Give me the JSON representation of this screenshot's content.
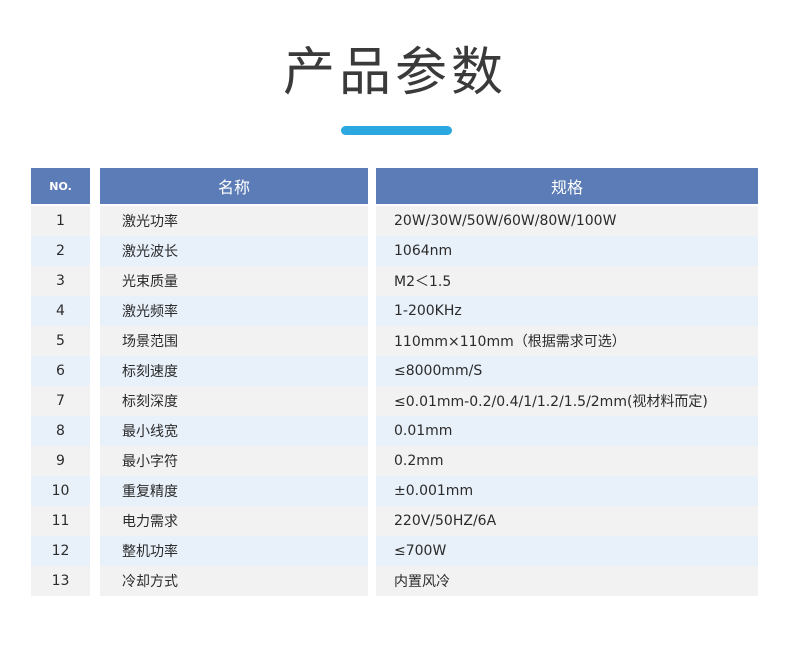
{
  "page": {
    "title": "产品参数"
  },
  "table": {
    "headers": {
      "no": "NO.",
      "name": "名称",
      "spec": "规格"
    },
    "rows": [
      {
        "no": "1",
        "name": "激光功率",
        "spec": "20W/30W/50W/60W/80W/100W"
      },
      {
        "no": "2",
        "name": "激光波长",
        "spec": "1064nm"
      },
      {
        "no": "3",
        "name": "光束质量",
        "spec": "M2＜1.5"
      },
      {
        "no": "4",
        "name": "激光频率",
        "spec": "1-200KHz"
      },
      {
        "no": "5",
        "name": "场景范围",
        "spec": "110mm×110mm（根据需求可选）"
      },
      {
        "no": "6",
        "name": "标刻速度",
        "spec": "≤8000mm/S"
      },
      {
        "no": "7",
        "name": "标刻深度",
        "spec": "≤0.01mm-0.2/0.4/1/1.2/1.5/2mm(视材料而定)"
      },
      {
        "no": "8",
        "name": "最小线宽",
        "spec": "0.01mm"
      },
      {
        "no": "9",
        "name": "最小字符",
        "spec": "0.2mm"
      },
      {
        "no": "10",
        "name": "重复精度",
        "spec": "±0.001mm"
      },
      {
        "no": "11",
        "name": "电力需求",
        "spec": " 220V/50HZ/6A"
      },
      {
        "no": "12",
        "name": "整机功率",
        "spec": "≤700W"
      },
      {
        "no": "13",
        "name": "冷却方式",
        "spec": "内置风冷"
      }
    ]
  },
  "colors": {
    "accent_bar": "#2aa8df",
    "header_bg": "#5b7cb6",
    "row_odd_bg": "#f2f2f2",
    "row_even_bg": "#e8f0fa"
  }
}
